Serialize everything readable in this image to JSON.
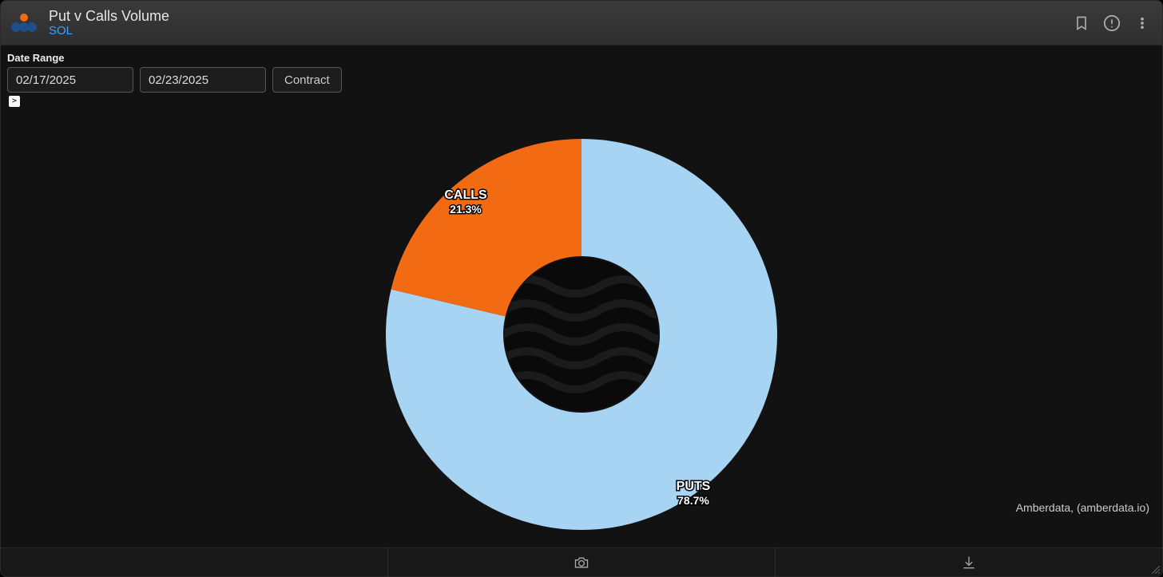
{
  "header": {
    "title": "Put v Calls Volume",
    "subtitle": "SOL"
  },
  "icons": {
    "bookmark": "bookmark-icon",
    "alert": "alert-circle-icon",
    "menu": "more-vertical-icon"
  },
  "controls": {
    "date_range_label": "Date Range",
    "date_start": "02/17/2025",
    "date_end": "02/23/2025",
    "contract_button": "Contract",
    "expand_glyph": ">"
  },
  "chart_data": {
    "type": "pie",
    "donut": true,
    "inner_radius_ratio": 0.4,
    "series": [
      {
        "name": "PUTS",
        "value": 78.7,
        "percent_label": "78.7%",
        "color": "#a6d4f2"
      },
      {
        "name": "CALLS",
        "value": 21.3,
        "percent_label": "21.3%",
        "color": "#f26a12"
      }
    ]
  },
  "attribution": "Amberdata, (amberdata.io)",
  "footer": {
    "camera": "camera-icon",
    "download": "download-icon"
  }
}
